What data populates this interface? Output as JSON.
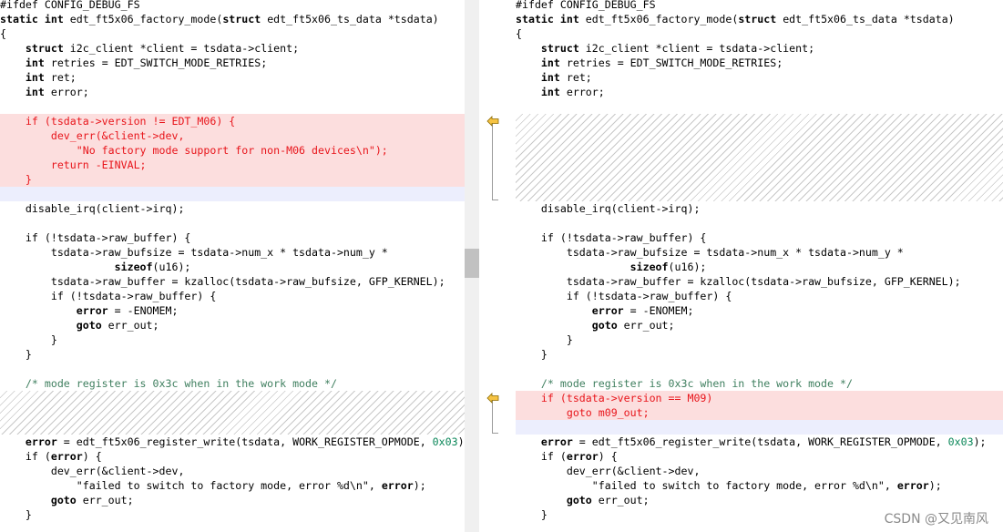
{
  "left": {
    "lines": [
      [
        {
          "t": "#ifdef CONFIG_DEBUG_FS",
          "c": "plain"
        }
      ],
      [
        {
          "t": "static int",
          "c": "kw"
        },
        {
          "t": " edt_ft5x06_factory_mode(",
          "c": "plain"
        },
        {
          "t": "struct",
          "c": "kw"
        },
        {
          "t": " edt_ft5x06_ts_data *tsdata)",
          "c": "plain"
        }
      ],
      [
        {
          "t": "{",
          "c": "plain"
        }
      ],
      [
        {
          "t": "    ",
          "c": "plain"
        },
        {
          "t": "struct",
          "c": "kw"
        },
        {
          "t": " i2c_client *client = tsdata->client;",
          "c": "plain"
        }
      ],
      [
        {
          "t": "    ",
          "c": "plain"
        },
        {
          "t": "int",
          "c": "kw"
        },
        {
          "t": " retries = EDT_SWITCH_MODE_RETRIES;",
          "c": "plain"
        }
      ],
      [
        {
          "t": "    ",
          "c": "plain"
        },
        {
          "t": "int",
          "c": "kw"
        },
        {
          "t": " ret;",
          "c": "plain"
        }
      ],
      [
        {
          "t": "    ",
          "c": "plain"
        },
        {
          "t": "int",
          "c": "kw"
        },
        {
          "t": " error;",
          "c": "plain"
        }
      ],
      [],
      [
        {
          "t": "    if (tsdata->version != EDT_M06) {",
          "c": "del"
        }
      ],
      [
        {
          "t": "        dev_err(&client->dev,",
          "c": "del"
        }
      ],
      [
        {
          "t": "            \"No factory mode support for non-M06 devices\\n\");",
          "c": "del"
        }
      ],
      [
        {
          "t": "        return -EINVAL;",
          "c": "del"
        }
      ],
      [
        {
          "t": "    }",
          "c": "del"
        }
      ],
      [],
      [
        {
          "t": "    disable_irq(client->irq);",
          "c": "plain"
        }
      ],
      [],
      [
        {
          "t": "    if (!tsdata->raw_buffer) {",
          "c": "plain"
        }
      ],
      [
        {
          "t": "        tsdata->raw_bufsize = tsdata->num_x * tsdata->num_y *",
          "c": "plain"
        }
      ],
      [
        {
          "t": "                  ",
          "c": "plain"
        },
        {
          "t": "sizeof",
          "c": "kw"
        },
        {
          "t": "(u16);",
          "c": "plain"
        }
      ],
      [
        {
          "t": "        tsdata->raw_buffer = kzalloc(tsdata->raw_bufsize, GFP_KERNEL);",
          "c": "plain"
        }
      ],
      [
        {
          "t": "        if (!tsdata->raw_buffer) {",
          "c": "plain"
        }
      ],
      [
        {
          "t": "            ",
          "c": "plain"
        },
        {
          "t": "error",
          "c": "kw"
        },
        {
          "t": " = -ENOMEM;",
          "c": "plain"
        }
      ],
      [
        {
          "t": "            ",
          "c": "plain"
        },
        {
          "t": "goto",
          "c": "kw"
        },
        {
          "t": " err_out;",
          "c": "plain"
        }
      ],
      [
        {
          "t": "        }",
          "c": "plain"
        }
      ],
      [
        {
          "t": "    }",
          "c": "plain"
        }
      ],
      [],
      [
        {
          "t": "    /* mode register is 0x3c when in the work mode */",
          "c": "com"
        }
      ],
      [],
      [],
      [],
      [
        {
          "t": "    ",
          "c": "plain"
        },
        {
          "t": "error",
          "c": "kw"
        },
        {
          "t": " = edt_ft5x06_register_write(tsdata, WORK_REGISTER_OPMODE, ",
          "c": "plain"
        },
        {
          "t": "0x03",
          "c": "num"
        },
        {
          "t": ");",
          "c": "plain"
        }
      ],
      [
        {
          "t": "    if (",
          "c": "plain"
        },
        {
          "t": "error",
          "c": "kw"
        },
        {
          "t": ") {",
          "c": "plain"
        }
      ],
      [
        {
          "t": "        dev_err(&client->dev,",
          "c": "plain"
        }
      ],
      [
        {
          "t": "            \"failed to switch to factory mode, error %d\\n\", ",
          "c": "plain"
        },
        {
          "t": "error",
          "c": "kw"
        },
        {
          "t": ");",
          "c": "plain"
        }
      ],
      [
        {
          "t": "        ",
          "c": "plain"
        },
        {
          "t": "goto",
          "c": "kw"
        },
        {
          "t": " err_out;",
          "c": "plain"
        }
      ],
      [
        {
          "t": "    }",
          "c": "plain"
        }
      ]
    ]
  },
  "right": {
    "lines": [
      [
        {
          "t": "#ifdef CONFIG_DEBUG_FS",
          "c": "plain"
        }
      ],
      [
        {
          "t": "static int",
          "c": "kw"
        },
        {
          "t": " edt_ft5x06_factory_mode(",
          "c": "plain"
        },
        {
          "t": "struct",
          "c": "kw"
        },
        {
          "t": " edt_ft5x06_ts_data *tsdata)",
          "c": "plain"
        }
      ],
      [
        {
          "t": "{",
          "c": "plain"
        }
      ],
      [
        {
          "t": "    ",
          "c": "plain"
        },
        {
          "t": "struct",
          "c": "kw"
        },
        {
          "t": " i2c_client *client = tsdata->client;",
          "c": "plain"
        }
      ],
      [
        {
          "t": "    ",
          "c": "plain"
        },
        {
          "t": "int",
          "c": "kw"
        },
        {
          "t": " retries = EDT_SWITCH_MODE_RETRIES;",
          "c": "plain"
        }
      ],
      [
        {
          "t": "    ",
          "c": "plain"
        },
        {
          "t": "int",
          "c": "kw"
        },
        {
          "t": " ret;",
          "c": "plain"
        }
      ],
      [
        {
          "t": "    ",
          "c": "plain"
        },
        {
          "t": "int",
          "c": "kw"
        },
        {
          "t": " error;",
          "c": "plain"
        }
      ],
      [],
      [],
      [],
      [],
      [],
      [],
      [],
      [
        {
          "t": "    disable_irq(client->irq);",
          "c": "plain"
        }
      ],
      [],
      [
        {
          "t": "    if (!tsdata->raw_buffer) {",
          "c": "plain"
        }
      ],
      [
        {
          "t": "        tsdata->raw_bufsize = tsdata->num_x * tsdata->num_y *",
          "c": "plain"
        }
      ],
      [
        {
          "t": "                  ",
          "c": "plain"
        },
        {
          "t": "sizeof",
          "c": "kw"
        },
        {
          "t": "(u16);",
          "c": "plain"
        }
      ],
      [
        {
          "t": "        tsdata->raw_buffer = kzalloc(tsdata->raw_bufsize, GFP_KERNEL);",
          "c": "plain"
        }
      ],
      [
        {
          "t": "        if (!tsdata->raw_buffer) {",
          "c": "plain"
        }
      ],
      [
        {
          "t": "            ",
          "c": "plain"
        },
        {
          "t": "error",
          "c": "kw"
        },
        {
          "t": " = -ENOMEM;",
          "c": "plain"
        }
      ],
      [
        {
          "t": "            ",
          "c": "plain"
        },
        {
          "t": "goto",
          "c": "kw"
        },
        {
          "t": " err_out;",
          "c": "plain"
        }
      ],
      [
        {
          "t": "        }",
          "c": "plain"
        }
      ],
      [
        {
          "t": "    }",
          "c": "plain"
        }
      ],
      [],
      [
        {
          "t": "    /* mode register is 0x3c when in the work mode */",
          "c": "com"
        }
      ],
      [
        {
          "t": "    if (tsdata->version == M09)",
          "c": "del"
        }
      ],
      [
        {
          "t": "        goto m09_out;",
          "c": "del"
        }
      ],
      [],
      [
        {
          "t": "    ",
          "c": "plain"
        },
        {
          "t": "error",
          "c": "kw"
        },
        {
          "t": " = edt_ft5x06_register_write(tsdata, WORK_REGISTER_OPMODE, ",
          "c": "plain"
        },
        {
          "t": "0x03",
          "c": "num"
        },
        {
          "t": ");",
          "c": "plain"
        }
      ],
      [
        {
          "t": "    if (",
          "c": "plain"
        },
        {
          "t": "error",
          "c": "kw"
        },
        {
          "t": ") {",
          "c": "plain"
        }
      ],
      [
        {
          "t": "        dev_err(&client->dev,",
          "c": "plain"
        }
      ],
      [
        {
          "t": "            \"failed to switch to factory mode, error %d\\n\", ",
          "c": "plain"
        },
        {
          "t": "error",
          "c": "kw"
        },
        {
          "t": ");",
          "c": "plain"
        }
      ],
      [
        {
          "t": "        ",
          "c": "plain"
        },
        {
          "t": "goto",
          "c": "kw"
        },
        {
          "t": " err_out;",
          "c": "plain"
        }
      ],
      [
        {
          "t": "    }",
          "c": "plain"
        }
      ]
    ]
  },
  "colors": {
    "deleted_text": "#e8151b",
    "deleted_bg": "#fcdede",
    "blank_bg": "#eceefd",
    "comment": "#3f7f5f",
    "number": "#098658",
    "arrow_fill": "#f6c343"
  },
  "icons": {
    "merge_arrow": "arrow-left-icon"
  },
  "watermark": "CSDN @又见南风"
}
